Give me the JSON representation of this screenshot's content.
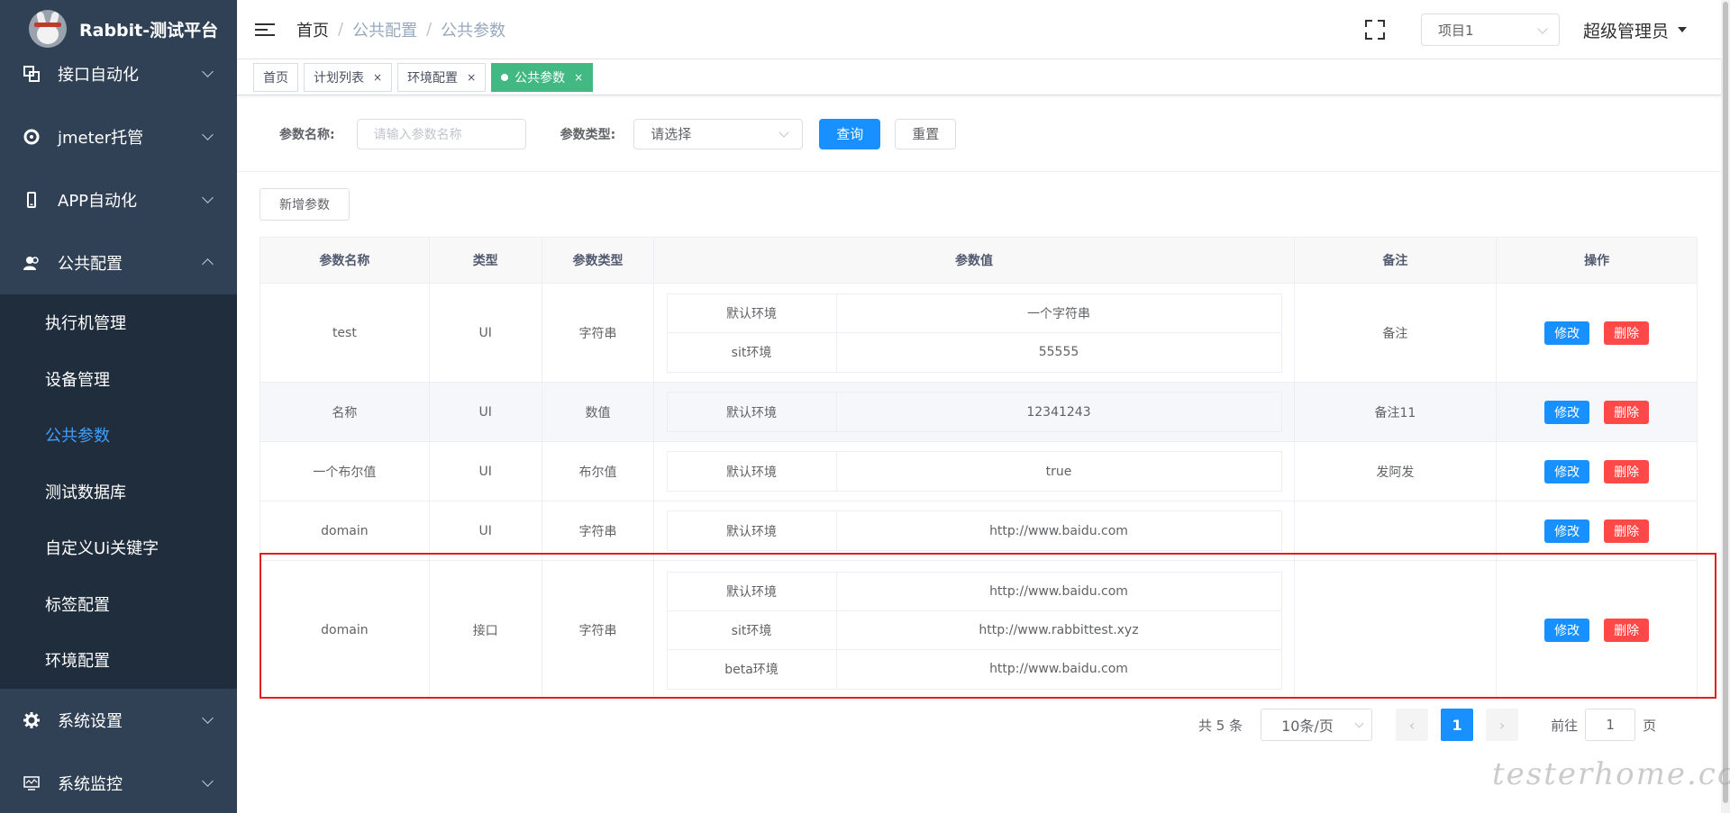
{
  "app": {
    "title": "Rabbit-测试平台"
  },
  "sidebar": {
    "items": [
      {
        "label": "接口自动化",
        "icon": "link-icon"
      },
      {
        "label": "jmeter托管",
        "icon": "aperture-icon"
      },
      {
        "label": "APP自动化",
        "icon": "mobile-icon"
      },
      {
        "label": "公共配置",
        "icon": "users-icon",
        "expanded": true
      },
      {
        "label": "系统设置",
        "icon": "gear-icon"
      },
      {
        "label": "系统监控",
        "icon": "monitor-icon"
      }
    ],
    "submenu": [
      "执行机管理",
      "设备管理",
      "公共参数",
      "测试数据库",
      "自定义Ui关键字",
      "标签配置",
      "环境配置"
    ],
    "active_sub": "公共参数"
  },
  "header": {
    "breadcrumb": [
      "首页",
      "公共配置",
      "公共参数"
    ],
    "project": "项目1",
    "user": "超级管理员"
  },
  "tags": [
    {
      "label": "首页",
      "closable": false
    },
    {
      "label": "计划列表",
      "closable": true
    },
    {
      "label": "环境配置",
      "closable": true
    },
    {
      "label": "公共参数",
      "closable": true,
      "active": true
    }
  ],
  "filter": {
    "name_label": "参数名称:",
    "name_placeholder": "请输入参数名称",
    "type_label": "参数类型:",
    "type_value": "请选择",
    "query": "查询",
    "reset": "重置"
  },
  "add_button": "新增参数",
  "table": {
    "headers": [
      "参数名称",
      "类型",
      "参数类型",
      "参数值",
      "备注",
      "操作"
    ],
    "edit_label": "修改",
    "delete_label": "删除",
    "rows": [
      {
        "name": "test",
        "kind": "UI",
        "param_type": "字符串",
        "values": [
          [
            "默认环境",
            "一个字符串"
          ],
          [
            "sit环境",
            "55555"
          ]
        ],
        "remark": "备注"
      },
      {
        "name": "名称",
        "kind": "UI",
        "param_type": "数值",
        "values": [
          [
            "默认环境",
            "12341243"
          ]
        ],
        "remark": "备注11"
      },
      {
        "name": "一个布尔值",
        "kind": "UI",
        "param_type": "布尔值",
        "values": [
          [
            "默认环境",
            "true"
          ]
        ],
        "remark": "发阿发"
      },
      {
        "name": "domain",
        "kind": "UI",
        "param_type": "字符串",
        "values": [
          [
            "默认环境",
            "http://www.baidu.com"
          ]
        ],
        "remark": ""
      },
      {
        "name": "domain",
        "kind": "接口",
        "param_type": "字符串",
        "values": [
          [
            "默认环境",
            "http://www.baidu.com"
          ],
          [
            "sit环境",
            "http://www.rabbittest.xyz"
          ],
          [
            "beta环境",
            "http://www.baidu.com"
          ]
        ],
        "remark": ""
      }
    ]
  },
  "pagination": {
    "total": "共 5 条",
    "page_size": "10条/页",
    "current": "1",
    "goto_prefix": "前往",
    "goto_value": "1",
    "goto_suffix": "页"
  },
  "watermark": "testerhome.com",
  "colors": {
    "sidebar": "#304156",
    "primary": "#1890ff",
    "danger": "#ff4949",
    "tag_active": "#42b983",
    "highlight_box": "#e02020"
  }
}
